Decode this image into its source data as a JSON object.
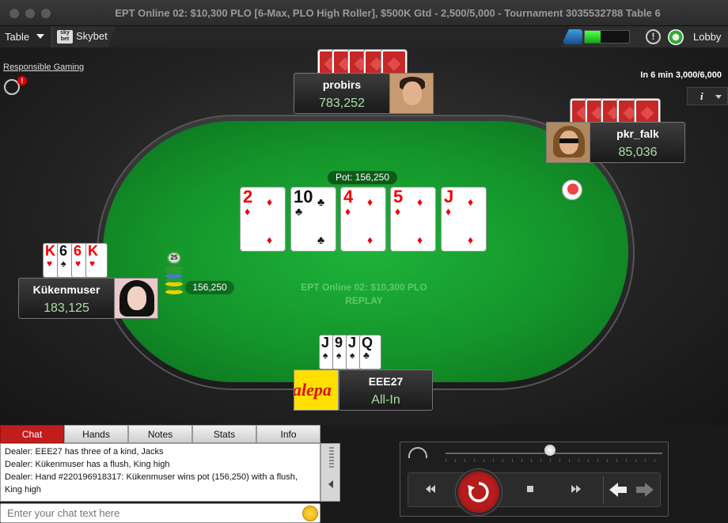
{
  "window": {
    "title": "EPT Online 02: $10,300 PLO [6-Max, PLO High Roller], $500K Gtd - 2,500/5,000 - Tournament 3035532788 Table 6"
  },
  "toolbar": {
    "table_label": "Table",
    "skybet_logo": "sky bet",
    "skybet_label": "Skybet",
    "battery_level": 0.35,
    "excl": "!",
    "lobby_label": "Lobby"
  },
  "responsible_gaming": {
    "label": "Responsible Gaming",
    "badge": "!"
  },
  "blinds_info": "In 6 min 3,000/6,000",
  "info_button": "i",
  "pot": "Pot: 156,250",
  "watermark": {
    "line1": "EPT Online 02: $10,300 PLO",
    "line2": "REPLAY"
  },
  "players": {
    "probirs": {
      "name": "probirs",
      "stack": "783,252"
    },
    "pkr_falk": {
      "name": "pkr_falk",
      "stack": "85,036"
    },
    "kukenmuser": {
      "name": "Kükenmuser",
      "stack": "183,125",
      "bet": "156,250",
      "chip_label": "25",
      "cards": [
        {
          "rank": "K",
          "suit": "♥"
        },
        {
          "rank": "6",
          "suit": "♠"
        },
        {
          "rank": "6",
          "suit": "♥"
        },
        {
          "rank": "K",
          "suit": "♥"
        }
      ]
    },
    "eee27": {
      "name": "EEE27",
      "stack": "All-In",
      "sponsor": "alepa",
      "cards": [
        {
          "rank": "J",
          "suit": "♠"
        },
        {
          "rank": "9",
          "suit": "♠"
        },
        {
          "rank": "J",
          "suit": "♠"
        },
        {
          "rank": "Q",
          "suit": "♣"
        }
      ]
    }
  },
  "board": [
    {
      "rank": "2",
      "suit": "♦"
    },
    {
      "rank": "10",
      "suit": "♣"
    },
    {
      "rank": "4",
      "suit": "♦"
    },
    {
      "rank": "5",
      "suit": "♦"
    },
    {
      "rank": "J",
      "suit": "♦"
    }
  ],
  "chat": {
    "tabs": [
      "Chat",
      "Hands",
      "Notes",
      "Stats",
      "Info"
    ],
    "active_tab": "Chat",
    "lines": [
      "Dealer: EEE27 has three of a kind, Jacks",
      "Dealer: Kükenmuser has a flush, King high",
      "Dealer: Hand #220196918317: Kükenmuser wins pot (156,250) with a flush, King high"
    ],
    "placeholder": "Enter your chat text here"
  },
  "replay": {
    "progress": 0.48
  },
  "colors": {
    "felt": "#14952a",
    "accent_red": "#c21d1d",
    "stack_green": "#a8e0a0"
  }
}
